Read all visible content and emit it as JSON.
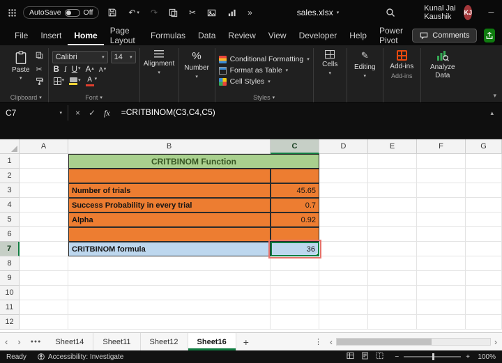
{
  "icons": {
    "chevron_down": "▾",
    "chevron_up": "▴",
    "undo": "↶",
    "redo": "↷",
    "scissors": "✂",
    "overflow": "»",
    "close": "×",
    "minimize": "─",
    "maximize": "□",
    "cancel": "×",
    "enter": "✓",
    "fx": "fx",
    "pencil": "✎",
    "more_sheets": "●●●",
    "vertical_dots": "⋮",
    "nav_left": "‹",
    "nav_right": "›",
    "add_sheet": "+",
    "zoom_out": "−",
    "zoom_in": "+",
    "percent": "%",
    "bold": "B",
    "italic": "I",
    "underline": "U",
    "font_letter": "A"
  },
  "titlebar": {
    "autosave_label": "AutoSave",
    "autosave_state": "Off",
    "filename": "sales.xlsx",
    "user_name": "Kunal Jai Kaushik",
    "user_initials": "KJ",
    "avatar_color": "#A4373A"
  },
  "menubar": {
    "items": [
      "File",
      "Insert",
      "Home",
      "Page Layout",
      "Formulas",
      "Data",
      "Review",
      "View",
      "Developer",
      "Help",
      "Power Pivot"
    ],
    "active_item": "Home",
    "comments_label": "Comments"
  },
  "ribbon": {
    "paste_label": "Paste",
    "clipboard_group_label": "Clipboard",
    "font_name": "Calibri",
    "font_size": "14",
    "font_group_label": "Font",
    "alignment_label": "Alignment",
    "number_label": "Number",
    "conditional_formatting_label": "Conditional Formatting",
    "format_as_table_label": "Format as Table",
    "cell_styles_label": "Cell Styles",
    "styles_group_label": "Styles",
    "cells_label": "Cells",
    "editing_label": "Editing",
    "addins_label": "Add-ins",
    "addins_group_label": "Add-ins",
    "analyze_data_label": "Analyze Data"
  },
  "formula_bar": {
    "name_box": "C7",
    "formula": "=CRITBINOM(C3,C4,C5)"
  },
  "grid": {
    "column_headers": [
      "A",
      "B",
      "C",
      "D",
      "E",
      "F",
      "G"
    ],
    "row_headers": [
      "1",
      "2",
      "3",
      "4",
      "5",
      "6",
      "7",
      "8",
      "9",
      "10",
      "11",
      "12"
    ],
    "selected_column": "C",
    "selected_row": "7",
    "merges": {
      "B1": 2
    },
    "cells": {
      "B1": "CRITBINOM Function",
      "B3": "Number of trials",
      "C3": "45.65",
      "B4": "Success Probability in every trial",
      "C4": "0.7",
      "B5": "Alpha",
      "C5": "0.92",
      "B7": "CRITBINOM formula",
      "C7": "36"
    },
    "cell_styles": {
      "B1": "c-title",
      "B2": "c-orange",
      "C2": "c-orange",
      "B3": "c-olabel",
      "C3": "c-oval",
      "B4": "c-olabel",
      "C4": "c-oval",
      "B5": "c-olabel",
      "C5": "c-oval",
      "B6": "c-orange",
      "C6": "c-orange",
      "B7": "c-blabel",
      "C7": "c-bval c-active"
    },
    "colors": {
      "title_bg": "#A9D08E",
      "title_text": "#375623",
      "orange_bg": "#ED7D31",
      "blue_bg": "#BDD7EE",
      "selection_green": "#107C41",
      "highlight_red": "#E8736C"
    }
  },
  "sheet_tabs": {
    "tabs": [
      "Sheet14",
      "Sheet11",
      "Sheet12",
      "Sheet16"
    ],
    "active_tab": "Sheet16"
  },
  "status_bar": {
    "ready_label": "Ready",
    "accessibility_label": "Accessibility: Investigate",
    "zoom_level": "100%"
  }
}
